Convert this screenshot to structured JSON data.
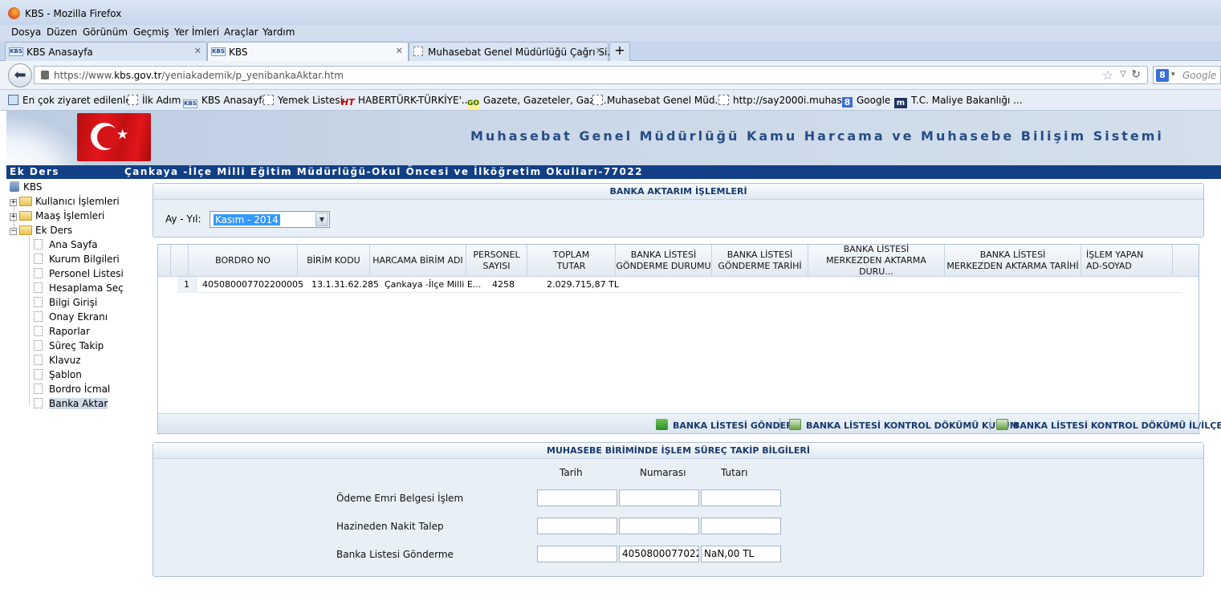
{
  "browser": {
    "window_title": "KBS - Mozilla Firefox",
    "menu": [
      "Dosya",
      "Düzen",
      "Görünüm",
      "Geçmiş",
      "Yer İmleri",
      "Araçlar",
      "Yardım"
    ],
    "tabs": [
      {
        "label": "KBS Anasayfa",
        "icon": "KBS",
        "active": false
      },
      {
        "label": "KBS",
        "icon": "KBS",
        "active": true
      },
      {
        "label": "Muhasebat Genel Müdürlüğü Çağrı Si...",
        "icon": "",
        "active": false
      }
    ],
    "new_tab": "+",
    "url_prefix": "https://www.",
    "url_domain": "kbs.gov.tr",
    "url_path": "/yeniakademik/p_yenibankaAktar.htm",
    "search_placeholder": "Google",
    "search_engine_icon": "8",
    "bookmarks": [
      {
        "label": "En çok ziyaret edilenler",
        "icon": "mag"
      },
      {
        "label": "İlk Adım",
        "icon": "blank"
      },
      {
        "label": "KBS Anasayfa",
        "icon": "kbs"
      },
      {
        "label": "Yemek Listesi",
        "icon": "blank"
      },
      {
        "label": "HABERTÜRK-TÜRKİYE'...",
        "icon": "ht"
      },
      {
        "label": "Gazete, Gazeteler, Gaze...",
        "icon": "go"
      },
      {
        "label": "Muhasebat Genel Müd...",
        "icon": "blank"
      },
      {
        "label": "http://say2000i.muhas...",
        "icon": "blank"
      },
      {
        "label": "Google",
        "icon": "goog"
      },
      {
        "label": "T.C. Maliye Bakanlığı ...",
        "icon": "m"
      }
    ],
    "bookmark_icon_text": {
      "kbs": "KBS",
      "ht": "HT",
      "go": "GO",
      "goog": "8",
      "m": "m"
    }
  },
  "app": {
    "system_title": "Muhasebat Genel Müdürlüğü Kamu Harcama ve Muhasebe Bilişim Sistemi",
    "module": "Ek Ders",
    "institution": "Çankaya -İlçe Milli Eğitim Müdürlüğü-Okul Öncesi ve İlköğretim Okulları-77022"
  },
  "tree": {
    "root": "KBS",
    "folders": [
      {
        "label": "Kullanıcı İşlemleri",
        "toggle": "+"
      },
      {
        "label": "Maaş İşlemleri",
        "toggle": "+"
      },
      {
        "label": "Ek Ders",
        "toggle": "−"
      }
    ],
    "items": [
      "Ana Sayfa",
      "Kurum Bilgileri",
      "Personel Listesi",
      "Hesaplama Seç",
      "Bilgi Girişi",
      "Onay Ekranı",
      "Raporlar",
      "Süreç Takip",
      "Klavuz",
      "Şablon",
      "Bordro İcmal",
      "Banka Aktar"
    ],
    "selected": "Banka Aktar"
  },
  "transfer": {
    "panel_title": "BANKA AKTARIM İŞLEMLERİ",
    "period_label": "Ay - Yıl:",
    "period_value": "Kasım - 2014",
    "columns": [
      {
        "line1": "BORDRO NO",
        "line2": ""
      },
      {
        "line1": "BİRİM KODU",
        "line2": ""
      },
      {
        "line1": "HARCAMA BİRİM ADI",
        "line2": ""
      },
      {
        "line1": "PERSONEL",
        "line2": "SAYISI"
      },
      {
        "line1": "TOPLAM",
        "line2": "TUTAR"
      },
      {
        "line1": "BANKA LİSTESİ",
        "line2": "GÖNDERME DURUMU"
      },
      {
        "line1": "BANKA LİSTESİ",
        "line2": "GÖNDERME TARİHİ"
      },
      {
        "line1": "BANKA LİSTESİ",
        "line2": "MERKEZDEN AKTARMA DURU..."
      },
      {
        "line1": "BANKA LİSTESİ",
        "line2": "MERKEZDEN AKTARMA TARİHİ"
      },
      {
        "line1": "İŞLEM YAPAN",
        "line2": "AD-SOYAD"
      }
    ],
    "rows": [
      {
        "index": "1",
        "bordro_no": "405080007702200005",
        "birim_kodu": "13.1.31.62.285",
        "harcama_birim_adi": "Çankaya -İlçe Milli E...",
        "personel_sayisi": "4258",
        "toplam_tutar": "2.029.715,87 TL",
        "gonderme_durumu": "",
        "gonderme_tarihi": "",
        "aktarma_durumu": "",
        "aktarma_tarihi": "",
        "islem_yapan": ""
      }
    ],
    "actions": [
      "BANKA LİSTESİ GÖNDER",
      "BANKA LİSTESİ KONTROL DÖKÜMÜ KURUM",
      "BANKA LİSTESİ KONTROL DÖKÜMÜ İL/İLÇE"
    ]
  },
  "tracking": {
    "panel_title": "MUHASEBE BİRİMİNDE İŞLEM SÜREÇ TAKİP BİLGİLERİ",
    "col_headers": [
      "Tarih",
      "Numarası",
      "Tutarı"
    ],
    "rows": [
      {
        "label": "Ödeme Emri Belgesi İşlem",
        "tarih": "",
        "numarasi": "",
        "tutari": ""
      },
      {
        "label": "Hazineden Nakit Talep",
        "tarih": "",
        "numarasi": "",
        "tutari": ""
      },
      {
        "label": "Banka Listesi Gönderme",
        "tarih": "",
        "numarasi": "4050800077022",
        "tutari": "NaN,00 TL"
      }
    ]
  }
}
